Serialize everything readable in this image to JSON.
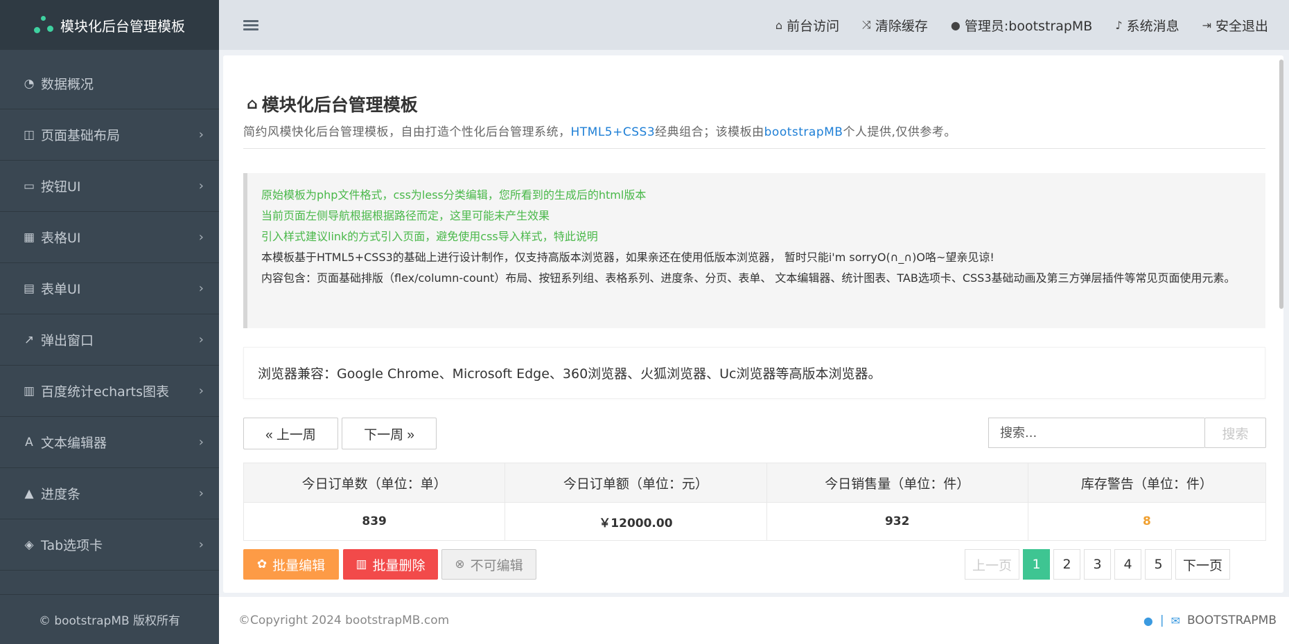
{
  "brand": {
    "title": "模块化后台管理模板"
  },
  "sidebar": {
    "items": [
      {
        "label": "数据概况",
        "icon": "dashboard-icon",
        "glyph": "◔",
        "has_children": false
      },
      {
        "label": "页面基础布局",
        "icon": "columns-icon",
        "glyph": "◫",
        "has_children": true
      },
      {
        "label": "按钮UI",
        "icon": "inbox-icon",
        "glyph": "▭",
        "has_children": true
      },
      {
        "label": "表格UI",
        "icon": "table-icon",
        "glyph": "▦",
        "has_children": true
      },
      {
        "label": "表单UI",
        "icon": "form-icon",
        "glyph": "▤",
        "has_children": true
      },
      {
        "label": "弹出窗口",
        "icon": "external-link-icon",
        "glyph": "↗",
        "has_children": true
      },
      {
        "label": "百度统计echarts图表",
        "icon": "bar-chart-icon",
        "glyph": "▥",
        "has_children": true
      },
      {
        "label": "文本编辑器",
        "icon": "font-icon",
        "glyph": "A",
        "has_children": true
      },
      {
        "label": "进度条",
        "icon": "road-icon",
        "glyph": "▲",
        "has_children": true
      },
      {
        "label": "Tab选项卡",
        "icon": "tags-icon",
        "glyph": "◈",
        "has_children": true
      }
    ],
    "footer": "© bootstrapMB 版权所有"
  },
  "topbar": {
    "links": [
      {
        "label": "前台访问",
        "icon": "home-icon",
        "glyph": "⌂"
      },
      {
        "label": "清除缓存",
        "icon": "random-icon",
        "glyph": "⤨"
      },
      {
        "label": "管理员:bootstrapMB",
        "icon": "user-icon",
        "glyph": "●"
      },
      {
        "label": "系统消息",
        "icon": "bell-icon",
        "glyph": "♪"
      },
      {
        "label": "安全退出",
        "icon": "sign-out-icon",
        "glyph": "⇥"
      }
    ]
  },
  "main": {
    "title": "模块化后台管理模板",
    "desc_part1": "简约风模快化后台管理模板，自由打造个性化后台管理系统，",
    "desc_hl1": "HTML5+CSS3",
    "desc_part2": "经典组合；该模板由",
    "desc_hl2": "bootstrapMB",
    "desc_part3": "个人提供,仅供参考。",
    "notice": [
      {
        "text": "原始模板为php文件格式，css为less分类编辑，您所看到的生成后的html版本",
        "green": true
      },
      {
        "text": "当前页面左侧导航根据根据路径而定，这里可能未产生效果",
        "green": true
      },
      {
        "text": "引入样式建议link的方式引入页面，避免使用css导入样式，特此说明",
        "green": true
      },
      {
        "text": "本模板基于HTML5+CSS3的基础上进行设计制作，仅支持高版本浏览器，如果亲还在使用低版本浏览器， 暂时只能i'm sorryO(∩_∩)O咯~望亲见谅!",
        "green": false
      },
      {
        "text": "内容包含：页面基础排版（flex/column-count）布局、按钮系列组、表格系列、进度条、分页、表单、 文本编辑器、统计图表、TAB选项卡、CSS3基础动画及第三方弹层插件等常见页面使用元素。",
        "green": false
      }
    ],
    "compat": "浏览器兼容：Google Chrome、Microsoft Edge、360浏览器、火狐浏览器、Uc浏览器等高版本浏览器。",
    "week_prev": "« 上一周",
    "week_next": "下一周 »",
    "search": {
      "placeholder": "搜索...",
      "button": "搜索"
    },
    "table": {
      "headers": [
        "今日订单数（单位：单）",
        "今日订单额（单位：元）",
        "今日销售量（单位：件）",
        "库存警告（单位：件）"
      ],
      "row": [
        "839",
        "￥12000.00",
        "932",
        "8"
      ]
    },
    "bulk_edit": "批量编辑",
    "bulk_delete": "批量删除",
    "no_edit": "不可编辑",
    "pagination": {
      "prev": "上一页",
      "pages": [
        "1",
        "2",
        "3",
        "4",
        "5"
      ],
      "current": "1",
      "next": "下一页"
    }
  },
  "footer": {
    "copyright": "©Copyright 2024 bootstrapMB.com",
    "brand": "BOOTSTRAPMB"
  },
  "colors": {
    "sidebar_bg": "#3a4752",
    "accent": "#3ec592",
    "warn": "#f0a030",
    "orange": "#fd9b46",
    "red": "#f24a4a",
    "link": "#1e7fd6"
  }
}
